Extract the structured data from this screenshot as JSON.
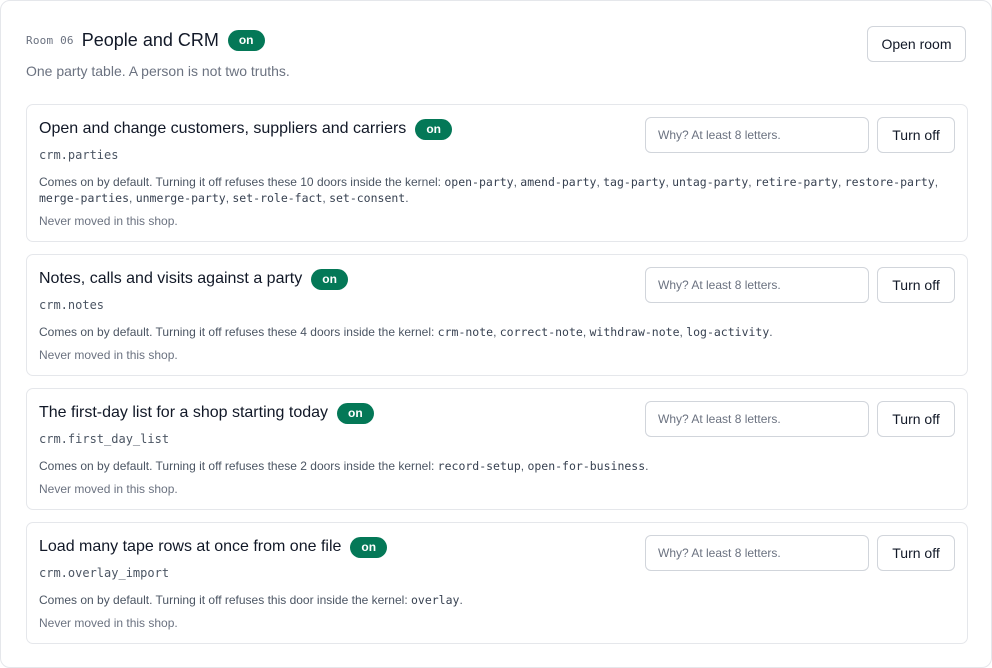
{
  "room": {
    "code": "Room 06",
    "title": "People and CRM",
    "badge": "on",
    "subtitle": "One party table. A person is not two truths.",
    "open_label": "Open room"
  },
  "cards": [
    {
      "title": "Open and change customers, suppliers and carriers",
      "badge": "on",
      "key": "crm.parties",
      "desc_prefix": "Comes on by default. Turning it off refuses these 10 doors inside the kernel: ",
      "doors": [
        "open-party",
        "amend-party",
        "tag-party",
        "untag-party",
        "retire-party",
        "restore-party",
        "merge-parties",
        "unmerge-party",
        "set-role-fact",
        "set-consent"
      ],
      "moved": "Never moved in this shop.",
      "placeholder": "Why? At least 8 letters.",
      "off_label": "Turn off"
    },
    {
      "title": "Notes, calls and visits against a party",
      "badge": "on",
      "key": "crm.notes",
      "desc_prefix": "Comes on by default. Turning it off refuses these 4 doors inside the kernel: ",
      "doors": [
        "crm-note",
        "correct-note",
        "withdraw-note",
        "log-activity"
      ],
      "moved": "Never moved in this shop.",
      "placeholder": "Why? At least 8 letters.",
      "off_label": "Turn off"
    },
    {
      "title": "The first-day list for a shop starting today",
      "badge": "on",
      "key": "crm.first_day_list",
      "desc_prefix": "Comes on by default. Turning it off refuses these 2 doors inside the kernel: ",
      "doors": [
        "record-setup",
        "open-for-business"
      ],
      "moved": "Never moved in this shop.",
      "placeholder": "Why? At least 8 letters.",
      "off_label": "Turn off"
    },
    {
      "title": "Load many tape rows at once from one file",
      "badge": "on",
      "key": "crm.overlay_import",
      "desc_prefix": "Comes on by default. Turning it off refuses this door inside the kernel: ",
      "doors": [
        "overlay"
      ],
      "moved": "Never moved in this shop.",
      "placeholder": "Why? At least 8 letters.",
      "off_label": "Turn off"
    }
  ]
}
